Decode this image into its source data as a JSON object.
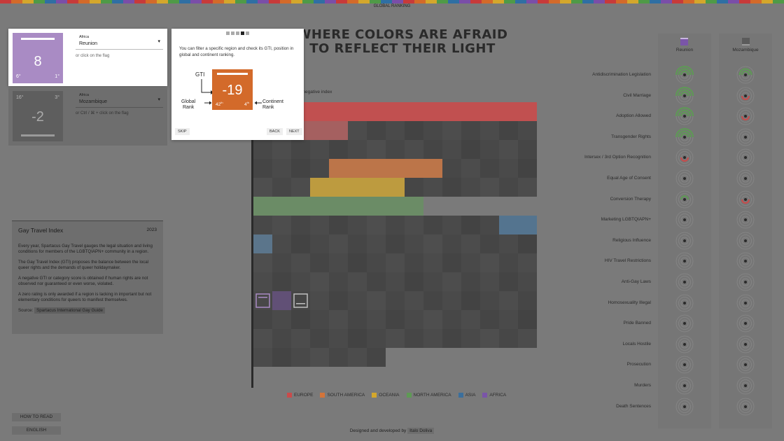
{
  "nav": {
    "title": "GLOBAL RANKING"
  },
  "headline": {
    "line1": "WHERE COLORS ARE AFRAID",
    "line2": "TO REFLECT THEIR LIGHT"
  },
  "selected_primary": {
    "region": "Africa",
    "country": "Reunion",
    "score": "8",
    "global_rank": "6°",
    "continent_rank": "1°",
    "hint": "or click on the flag",
    "color": "#a98bc4"
  },
  "selected_secondary": {
    "region": "Africa",
    "country": "Mozambique",
    "score": "-2",
    "global_rank": "16°",
    "continent_rank": "3°",
    "hint": "or Ctrl / ⌘ + click on the flag"
  },
  "tutorial": {
    "text": "You can filter a specific region and check its GTI, position in global and continent ranking.",
    "gti_label": "GTI",
    "example_score": "-19",
    "example_global": "42",
    "example_global_sup": "th",
    "example_continent": "4",
    "example_continent_sup": "th",
    "global_label_1": "Global",
    "global_label_2": "Rank",
    "continent_label_1": "Continent",
    "continent_label_2": "Rank",
    "skip": "SKIP",
    "back": "BACK",
    "next": "NEXT",
    "steps": 5,
    "current_step": 4
  },
  "partial_caption": "d negative index",
  "info": {
    "title": "Gay Travel Index",
    "year": "2023",
    "p1": "Every year, Spartacus Gay Travel gauges the legal situation and living conditions for members of the LGBTQIAPN+ community in a region.",
    "p2": "The Gay Travel Index (GTI) proposes the balance between the local queer rights and the demands of queer holidaymaker.",
    "p3": "A negative GTI or category score is obtained if human rights are not observed nor guaranteed or even worse, violated.",
    "p4": "A zero rating is only awarded if a region is lacking in important but not elementary conditions for queers to manifest themselves.",
    "source_label": "Source:",
    "source_value": "Spartacus International Gay Guide"
  },
  "buttons": {
    "how_to_read": "HOW TO READ",
    "language": "ENGLISH"
  },
  "legend": [
    {
      "label": "EUROPE",
      "color": "#c94b4b"
    },
    {
      "label": "SOUTH AMERICA",
      "color": "#d3743a"
    },
    {
      "label": "OCEANIA",
      "color": "#d4a72c"
    },
    {
      "label": "NORTH AMERICA",
      "color": "#5e9a55"
    },
    {
      "label": "ASIA",
      "color": "#3b6f9c"
    },
    {
      "label": "AFRICA",
      "color": "#7a55a8"
    }
  ],
  "compare": {
    "col1": "Reunion",
    "col2": "Mozambique",
    "rows": [
      "Antidiscrimination Legislation",
      "Civil Marriage",
      "Adoption Allowed",
      "Transgender Rights",
      "Intersex / 3rd Option Recognition",
      "Equal Age of Consent",
      "Conversion Therapy",
      "Marketing LGBTQIAPN+",
      "Religious Influence",
      "HIV Travel Restrictions",
      "Anti-Gay Laws",
      "Homosexuality Illegal",
      "Pride Banned",
      "Locals Hostile",
      "Prosecution",
      "Murders",
      "Death Sentences"
    ],
    "reunion_status": [
      "pos3",
      "pos3",
      "pos3",
      "pos3",
      "neg1",
      "zero",
      "pos1",
      "zero",
      "zero",
      "zero",
      "zero",
      "zero",
      "zero",
      "zero",
      "zero",
      "zero",
      "zero"
    ],
    "mozambique_status": [
      "pos2",
      "neg1",
      "neg1",
      "zero",
      "zero",
      "zero",
      "neg1",
      "zero",
      "zero",
      "zero",
      "zero",
      "zero",
      "zero",
      "zero",
      "zero",
      "zero",
      "zero"
    ]
  },
  "footer": {
    "text": "Designed and developed by",
    "author": "Italo Doliva"
  }
}
